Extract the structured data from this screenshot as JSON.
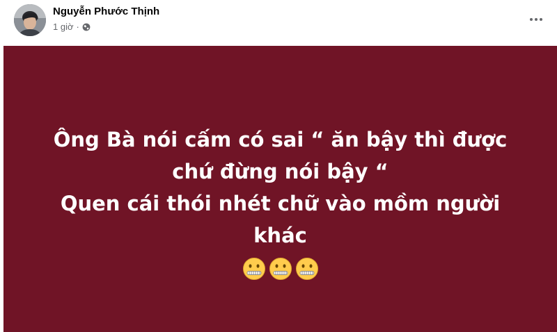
{
  "author": {
    "name": "Nguyễn Phước Thịnh",
    "time": "1 giờ",
    "separator": "·",
    "privacy_icon": "globe-icon",
    "avatar_icon": "avatar"
  },
  "menu": {
    "icon": "more-horizontal-icon"
  },
  "post": {
    "background_color": "#701426",
    "text_color": "#ffffff",
    "lines": [
      "Ông Bà nói cấm có sai “ ăn bậy thì được",
      "chứ đừng nói bậy “",
      "Quen cái thói nhét chữ vào mồm người",
      "khác"
    ],
    "emojis": [
      "zipper-mouth-face",
      "zipper-mouth-face",
      "zipper-mouth-face"
    ]
  }
}
